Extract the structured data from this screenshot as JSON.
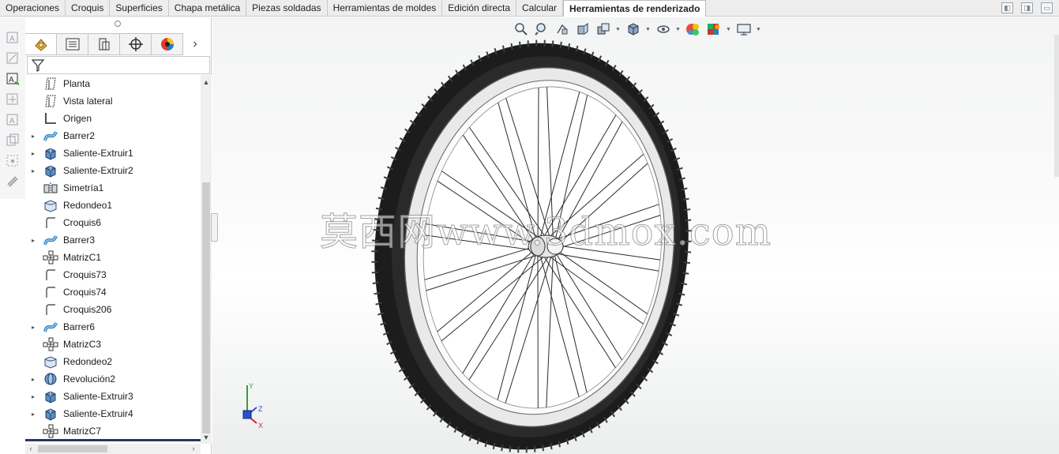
{
  "ribbon": {
    "tabs": [
      {
        "label": "Operaciones"
      },
      {
        "label": "Croquis"
      },
      {
        "label": "Superficies"
      },
      {
        "label": "Chapa metálica"
      },
      {
        "label": "Piezas soldadas"
      },
      {
        "label": "Herramientas de moldes"
      },
      {
        "label": "Edición directa"
      },
      {
        "label": "Calcular"
      },
      {
        "label": "Herramientas de renderizado"
      }
    ],
    "active_tab": "Herramientas de renderizado"
  },
  "feature_tree": {
    "items": [
      {
        "label": "Planta",
        "icon": "plane-icon",
        "expandable": false
      },
      {
        "label": "Vista lateral",
        "icon": "plane-icon",
        "expandable": false
      },
      {
        "label": "Origen",
        "icon": "origin-icon",
        "expandable": false
      },
      {
        "label": "Barrer2",
        "icon": "sweep-icon",
        "expandable": true
      },
      {
        "label": "Saliente-Extruir1",
        "icon": "extrude-icon",
        "expandable": true
      },
      {
        "label": "Saliente-Extruir2",
        "icon": "extrude-icon",
        "expandable": true
      },
      {
        "label": "Simetría1",
        "icon": "mirror-icon",
        "expandable": false
      },
      {
        "label": "Redondeo1",
        "icon": "fillet-icon",
        "expandable": false
      },
      {
        "label": "Croquis6",
        "icon": "sketch-icon",
        "expandable": false
      },
      {
        "label": "Barrer3",
        "icon": "sweep-icon",
        "expandable": true
      },
      {
        "label": "MatrizC1",
        "icon": "circular-pattern-icon",
        "expandable": false
      },
      {
        "label": "Croquis73",
        "icon": "sketch-icon",
        "expandable": false
      },
      {
        "label": "Croquis74",
        "icon": "sketch-icon",
        "expandable": false
      },
      {
        "label": "Croquis206",
        "icon": "sketch-icon",
        "expandable": false
      },
      {
        "label": "Barrer6",
        "icon": "sweep-icon",
        "expandable": true
      },
      {
        "label": "MatrizC3",
        "icon": "circular-pattern-icon",
        "expandable": false
      },
      {
        "label": "Redondeo2",
        "icon": "fillet-icon",
        "expandable": false
      },
      {
        "label": "Revolución2",
        "icon": "revolve-icon",
        "expandable": true
      },
      {
        "label": "Saliente-Extruir3",
        "icon": "extrude-icon",
        "expandable": true
      },
      {
        "label": "Saliente-Extruir4",
        "icon": "extrude-icon",
        "expandable": true
      },
      {
        "label": "MatrizC7",
        "icon": "circular-pattern-icon",
        "expandable": false
      }
    ]
  },
  "viewport": {
    "watermark": "莫西网www.3dmox.com",
    "triad": {
      "x": "X",
      "y": "Y",
      "z": "Z"
    }
  },
  "colors": {
    "accent": "#27385d",
    "tire": "#1c1c1c",
    "rim": "#e9e9e9",
    "axis_x": "#d4242a",
    "axis_y": "#3c9a3c",
    "axis_z": "#2a4fd0"
  }
}
